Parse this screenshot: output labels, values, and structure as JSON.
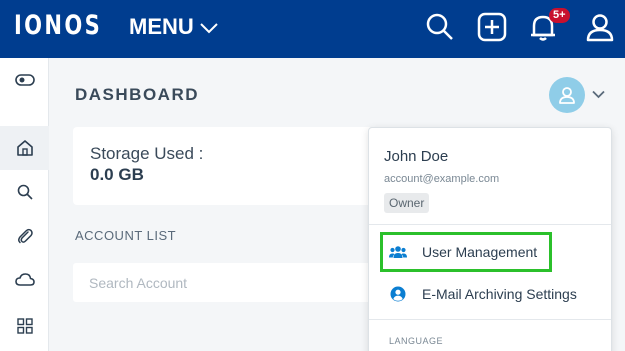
{
  "header": {
    "logo": "IONOS",
    "menu_label": "MENU",
    "notification_badge": "5+",
    "icons": [
      "search-icon",
      "add-icon",
      "bell-icon",
      "user-icon"
    ]
  },
  "sidebar": {
    "items": [
      {
        "name": "toggle-icon"
      },
      {
        "name": "home-icon"
      },
      {
        "name": "search-icon"
      },
      {
        "name": "paperclip-icon"
      },
      {
        "name": "cloud-icon"
      },
      {
        "name": "grid-icon"
      }
    ]
  },
  "main": {
    "title": "DASHBOARD",
    "storage_label": "Storage Used :",
    "storage_value": "0.0 GB",
    "account_list_label": "ACCOUNT LIST",
    "search_placeholder": "Search Account"
  },
  "user_menu": {
    "name": "John Doe",
    "email": "account@example.com",
    "role": "Owner",
    "items": [
      {
        "label": "User Management",
        "icon": "users-icon"
      },
      {
        "label": "E-Mail Archiving Settings",
        "icon": "user-circle-icon"
      }
    ],
    "language_label": "LANGUAGE"
  },
  "colors": {
    "header_bg": "#003d8f",
    "avatar_bg": "#8fcde8",
    "highlight": "#2bc02b",
    "accent_blue": "#0b7ed1",
    "badge": "#c8102e"
  }
}
